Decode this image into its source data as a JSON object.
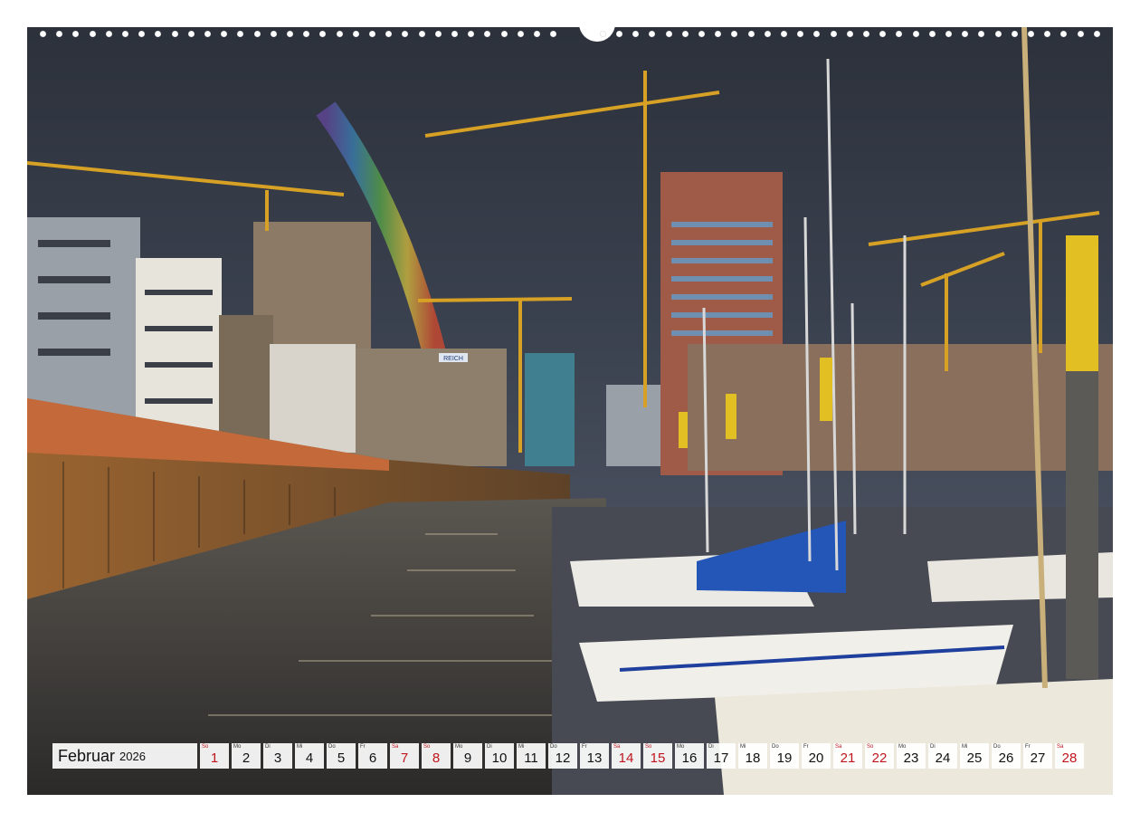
{
  "calendar": {
    "month": "Februar",
    "year": "2026",
    "days": [
      {
        "wd": "So",
        "num": "1",
        "red": true
      },
      {
        "wd": "Mo",
        "num": "2",
        "red": false
      },
      {
        "wd": "Di",
        "num": "3",
        "red": false
      },
      {
        "wd": "Mi",
        "num": "4",
        "red": false
      },
      {
        "wd": "Do",
        "num": "5",
        "red": false
      },
      {
        "wd": "Fr",
        "num": "6",
        "red": false
      },
      {
        "wd": "Sa",
        "num": "7",
        "red": true
      },
      {
        "wd": "So",
        "num": "8",
        "red": true
      },
      {
        "wd": "Mo",
        "num": "9",
        "red": false
      },
      {
        "wd": "Di",
        "num": "10",
        "red": false
      },
      {
        "wd": "Mi",
        "num": "11",
        "red": false
      },
      {
        "wd": "Do",
        "num": "12",
        "red": false
      },
      {
        "wd": "Fr",
        "num": "13",
        "red": false
      },
      {
        "wd": "Sa",
        "num": "14",
        "red": true
      },
      {
        "wd": "So",
        "num": "15",
        "red": true
      },
      {
        "wd": "Mo",
        "num": "16",
        "red": false
      },
      {
        "wd": "Di",
        "num": "17",
        "red": false
      },
      {
        "wd": "Mi",
        "num": "18",
        "red": false
      },
      {
        "wd": "Do",
        "num": "19",
        "red": false
      },
      {
        "wd": "Fr",
        "num": "20",
        "red": false
      },
      {
        "wd": "Sa",
        "num": "21",
        "red": true
      },
      {
        "wd": "So",
        "num": "22",
        "red": true
      },
      {
        "wd": "Mo",
        "num": "23",
        "red": false
      },
      {
        "wd": "Di",
        "num": "24",
        "red": false
      },
      {
        "wd": "Mi",
        "num": "25",
        "red": false
      },
      {
        "wd": "Do",
        "num": "26",
        "red": false
      },
      {
        "wd": "Fr",
        "num": "27",
        "red": false
      },
      {
        "wd": "Sa",
        "num": "28",
        "red": true
      }
    ]
  },
  "photo": {
    "sign_text": "REICH"
  },
  "colors": {
    "sunday_red": "#c0141e",
    "sky": "#3a4150",
    "water": "#3d3a36",
    "quay_wall": "#8a5a2b",
    "crane_yellow": "#d9a21e",
    "sail_cover_blue": "#1f4fa8"
  }
}
